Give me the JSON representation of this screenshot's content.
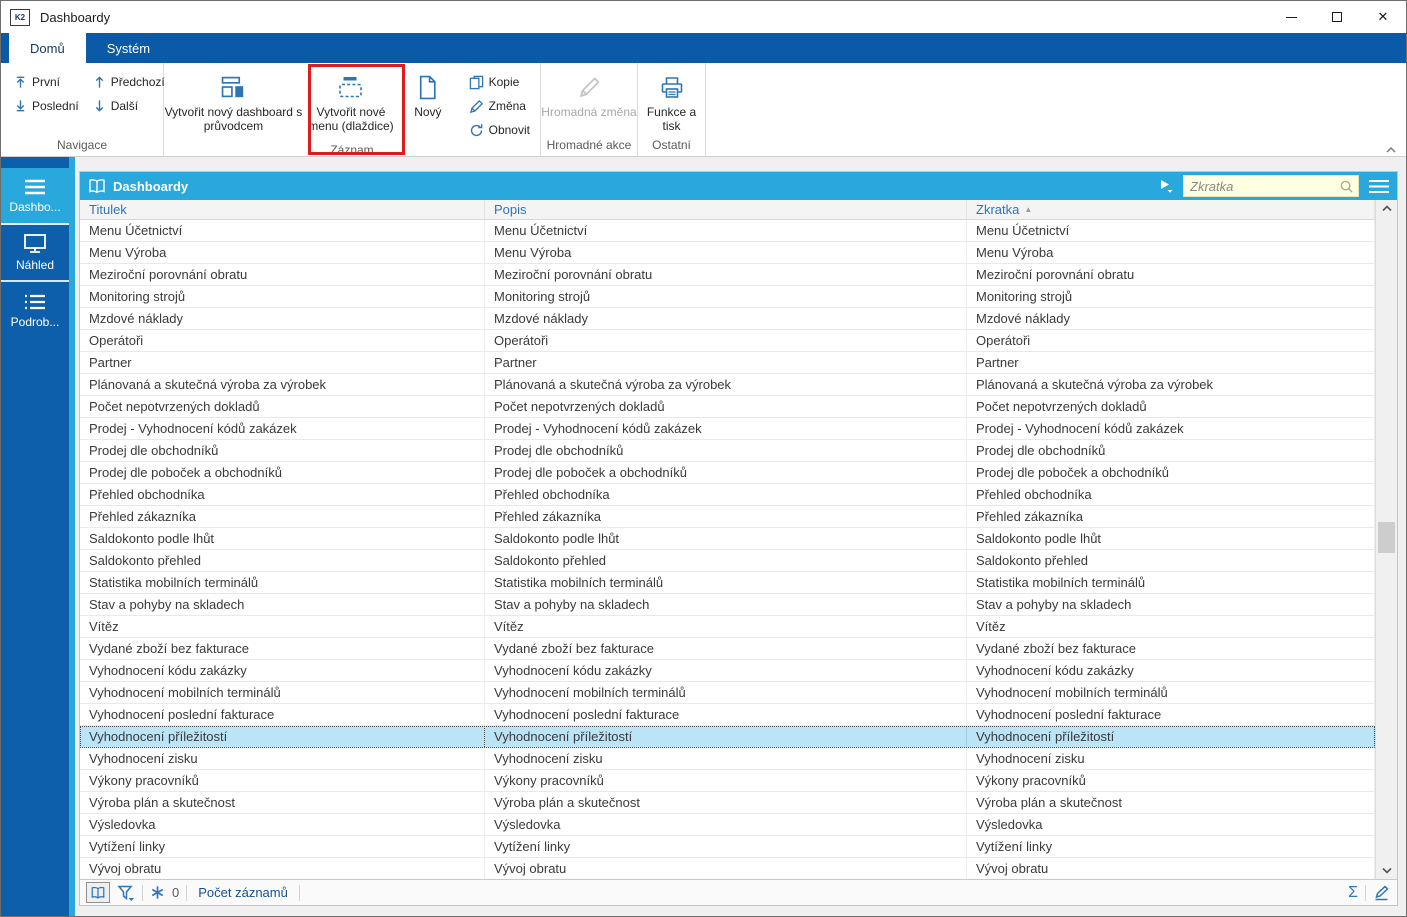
{
  "window": {
    "logo_text": "K2",
    "title": "Dashboardy"
  },
  "colors": {
    "ribbon_blue": "#0B5AA7",
    "sidebar_blue": "#0D5FAC",
    "accent_cyan": "#29A8DE",
    "selected_row": "#BCE4F7",
    "icon_blue": "#2E75B6",
    "annotation_red": "#E01B1B"
  },
  "ribbon": {
    "tabs": [
      {
        "label": "Domů"
      },
      {
        "label": "Systém"
      }
    ],
    "nav": {
      "first": "První",
      "last": "Poslední",
      "previous": "Předchozí",
      "next": "Další"
    },
    "record": {
      "create_dashboard": "Vytvořit nový dashboard s průvodcem",
      "create_menu": "Vytvořit nové menu (dlaždice)",
      "new": "Nový",
      "copy": "Kopie",
      "change": "Změna",
      "refresh": "Obnovit"
    },
    "bulk": {
      "bulk_change": "Hromadná změna"
    },
    "other": {
      "functions_print": "Funkce a tisk"
    },
    "group_labels": {
      "navigation": "Navigace",
      "record": "Záznam",
      "bulk": "Hromadné akce",
      "other": "Ostatní"
    }
  },
  "sidebar": {
    "items": [
      {
        "label": "Dashbo..."
      },
      {
        "label": "Náhled"
      },
      {
        "label": "Podrob..."
      }
    ]
  },
  "panel": {
    "title": "Dashboardy",
    "search_placeholder": "Zkratka",
    "columns": [
      {
        "label": "Titulek"
      },
      {
        "label": "Popis"
      },
      {
        "label": "Zkratka",
        "sorted": "asc"
      }
    ],
    "rows": [
      "Menu Účetnictví",
      "Menu Výroba",
      "Meziroční porovnání obratu",
      "Monitoring strojů",
      "Mzdové náklady",
      "Operátoři",
      "Partner",
      "Plánovaná a skutečná výroba za výrobek",
      "Počet nepotvrzených dokladů",
      "Prodej - Vyhodnocení kódů zakázek",
      "Prodej dle obchodníků",
      "Prodej dle poboček a obchodníků",
      "Přehled obchodníka",
      "Přehled zákazníka",
      "Saldokonto podle lhůt",
      "Saldokonto přehled",
      "Statistika mobilních terminálů",
      "Stav a pohyby na skladech",
      "Vítěz",
      "Vydané zboží bez fakturace",
      "Vyhodnocení kódu zakázky",
      "Vyhodnocení mobilních terminálů",
      "Vyhodnocení poslední fakturace",
      "Vyhodnocení příležitostí",
      "Vyhodnocení zisku",
      "Výkony pracovníků",
      "Výroba plán a skutečnost",
      "Výsledovka",
      "Vytížení linky",
      "Vývoj obratu"
    ],
    "selected_row_index": 23
  },
  "statusbar": {
    "count": "0",
    "count_label": "Počet záznamů"
  },
  "glyphs": {
    "sort_asc": "▲",
    "sigma": "Σ",
    "close": "✕"
  }
}
